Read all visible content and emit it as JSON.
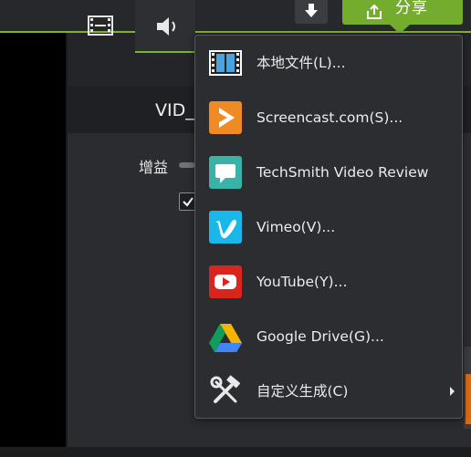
{
  "toolbar": {
    "download_icon": "download-icon",
    "share_label": "分享",
    "share_icon": "share-upload-icon"
  },
  "tabs": [
    {
      "name": "visual-properties",
      "icon": "film-icon"
    },
    {
      "name": "audio-properties",
      "icon": "speaker-icon",
      "active": true
    }
  ],
  "properties": {
    "clip_name": "VID_",
    "gain_label": "增益"
  },
  "share_menu": {
    "items": [
      {
        "label": "本地文件(L)...",
        "icon": "film-strip-icon"
      },
      {
        "label": "Screencast.com(S)...",
        "icon": "screencast-icon"
      },
      {
        "label": "TechSmith Video Review",
        "icon": "video-review-icon"
      },
      {
        "label": "Vimeo(V)...",
        "icon": "vimeo-icon"
      },
      {
        "label": "YouTube(Y)...",
        "icon": "youtube-icon"
      },
      {
        "label": "Google Drive(G)...",
        "icon": "google-drive-icon"
      },
      {
        "label": "自定义生成(C)",
        "icon": "tools-icon",
        "has_submenu": true
      }
    ]
  },
  "colors": {
    "accent_green": "#74ad2d",
    "screencast_orange": "#f08a24",
    "video_review_teal": "#39b3a8",
    "vimeo_blue": "#1ab7ea",
    "youtube_red": "#e62117"
  }
}
